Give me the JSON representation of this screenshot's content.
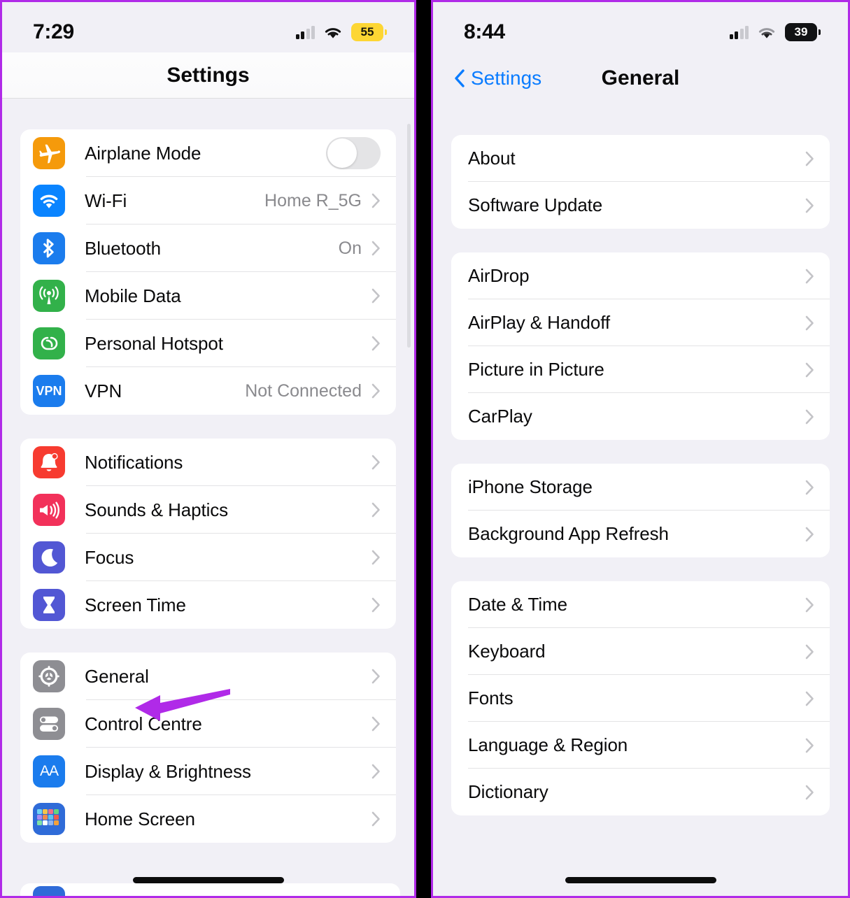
{
  "theme": {
    "accent_blue": "#0a7cff",
    "annotation_purple": "#b02ae8",
    "frame_purple": "#b02ae8",
    "page_background": "#f1f0f6",
    "card_background": "#ffffff",
    "secondary_text": "#8a8a8e"
  },
  "left_panel": {
    "status_bar": {
      "time": "7:29",
      "signal_icon": "cellular-bars-icon",
      "wifi_icon": "wifi-icon",
      "battery_percent": "55",
      "battery_style": "low-power-yellow"
    },
    "nav": {
      "title": "Settings"
    },
    "groups": [
      {
        "id": "connectivity",
        "rows": [
          {
            "label": "Airplane Mode",
            "icon": "airplane-icon",
            "icon_color": "#f59a0b",
            "control": "toggle",
            "toggle_on": false
          },
          {
            "label": "Wi-Fi",
            "icon": "wifi-icon",
            "icon_color": "#0a84ff",
            "value": "Home R_5G",
            "control": "chevron"
          },
          {
            "label": "Bluetooth",
            "icon": "bluetooth-icon",
            "icon_color": "#1b7ced",
            "value": "On",
            "control": "chevron"
          },
          {
            "label": "Mobile Data",
            "icon": "cellular-antenna-icon",
            "icon_color": "#32b14a",
            "value": "",
            "control": "chevron"
          },
          {
            "label": "Personal Hotspot",
            "icon": "hotspot-link-icon",
            "icon_color": "#32b14a",
            "value": "",
            "control": "chevron"
          },
          {
            "label": "VPN",
            "icon": "vpn-icon",
            "icon_color": "#1b7ced",
            "value": "Not Connected",
            "control": "chevron",
            "icon_text": "VPN"
          }
        ]
      },
      {
        "id": "alerts",
        "rows": [
          {
            "label": "Notifications",
            "icon": "bell-icon",
            "icon_color": "#f73b30",
            "value": "",
            "control": "chevron"
          },
          {
            "label": "Sounds & Haptics",
            "icon": "speaker-icon",
            "icon_color": "#f2315a",
            "value": "",
            "control": "chevron"
          },
          {
            "label": "Focus",
            "icon": "moon-icon",
            "icon_color": "#5257d4",
            "value": "",
            "control": "chevron"
          },
          {
            "label": "Screen Time",
            "icon": "hourglass-icon",
            "icon_color": "#5257d4",
            "value": "",
            "control": "chevron"
          }
        ]
      },
      {
        "id": "system",
        "rows": [
          {
            "label": "General",
            "icon": "gear-icon",
            "icon_color": "#8e8e93",
            "value": "",
            "control": "chevron"
          },
          {
            "label": "Control Centre",
            "icon": "control-centre-icon",
            "icon_color": "#8e8e93",
            "value": "",
            "control": "chevron"
          },
          {
            "label": "Display & Brightness",
            "icon": "display-brightness-icon",
            "icon_color": "#1b7ced",
            "value": "",
            "control": "chevron",
            "icon_text": "AA"
          },
          {
            "label": "Home Screen",
            "icon": "home-screen-icon",
            "icon_color": "#2f6bd8",
            "value": "",
            "control": "chevron"
          }
        ]
      }
    ]
  },
  "right_panel": {
    "status_bar": {
      "time": "8:44",
      "signal_icon": "cellular-bars-icon",
      "wifi_icon": "wifi-icon",
      "battery_percent": "39",
      "battery_style": "normal-dark"
    },
    "nav": {
      "back_label": "Settings",
      "title": "General"
    },
    "groups": [
      {
        "id": "about-update",
        "rows": [
          {
            "label": "About"
          },
          {
            "label": "Software Update"
          }
        ]
      },
      {
        "id": "sharing",
        "rows": [
          {
            "label": "AirDrop"
          },
          {
            "label": "AirPlay & Handoff"
          },
          {
            "label": "Picture in Picture"
          },
          {
            "label": "CarPlay"
          }
        ]
      },
      {
        "id": "storage",
        "rows": [
          {
            "label": "iPhone Storage"
          },
          {
            "label": "Background App Refresh"
          }
        ]
      },
      {
        "id": "localization",
        "rows": [
          {
            "label": "Date & Time"
          },
          {
            "label": "Keyboard"
          },
          {
            "label": "Fonts"
          },
          {
            "label": "Language & Region"
          },
          {
            "label": "Dictionary"
          }
        ]
      }
    ]
  },
  "annotations": [
    {
      "id": "arrow-general",
      "points_to": "General",
      "panel": "left",
      "color": "#b02ae8",
      "direction": "left"
    },
    {
      "id": "arrow-software-update",
      "points_to": "Software Update",
      "panel": "right",
      "color": "#b02ae8",
      "direction": "left"
    }
  ]
}
